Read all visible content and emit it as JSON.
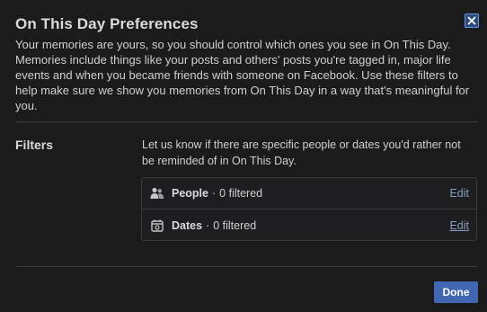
{
  "dialog": {
    "title": "On This Day Preferences",
    "intro": "Your memories are yours, so you should control which ones you see in On This Day. Memories include things like your posts and others' posts you're tagged in, major life events and when you became friends with someone on Facebook. Use these filters to help make sure we show you memories from On This Day in a way that's meaningful for you.",
    "close_icon": "close-icon"
  },
  "filters": {
    "heading": "Filters",
    "description": "Let us know if there are specific people or dates you'd rather not be reminded of in On This Day.",
    "separator": "·",
    "items": [
      {
        "name": "People",
        "count": "0 filtered",
        "edit_label": "Edit",
        "icon": "people-icon"
      },
      {
        "name": "Dates",
        "count": "0 filtered",
        "edit_label": "Edit",
        "icon": "calendar-icon"
      }
    ]
  },
  "footer": {
    "done_label": "Done"
  },
  "colors": {
    "background": "#1b1b1c",
    "primary_button": "#4267b2",
    "link": "#8b9dc3",
    "text": "#cfd0d2"
  }
}
